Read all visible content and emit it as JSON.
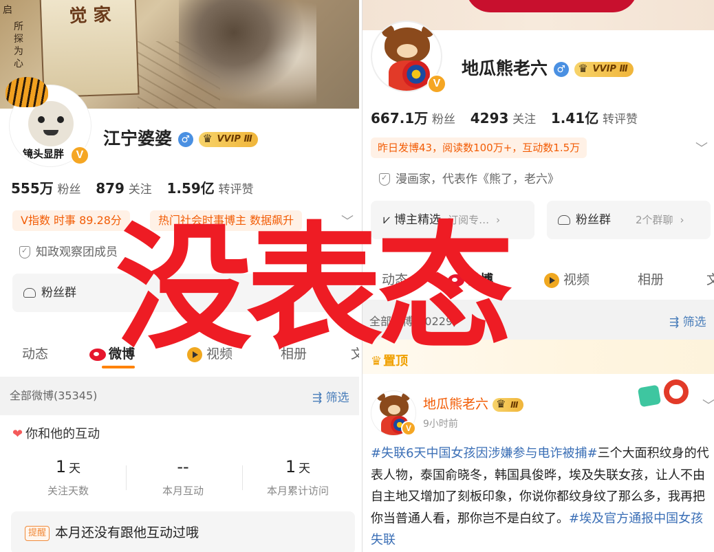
{
  "left": {
    "banner_vertical_1": "启",
    "banner_vertical_2": "所探为心",
    "book_title": "觉 家",
    "avatar_caption": "镜头显胖",
    "v_badge": "V",
    "name": "江宁婆婆",
    "gender_symbol": "♂",
    "vip_label": "VVIP Ⅲ",
    "stats": {
      "followers_value": "555万",
      "followers_label": "粉丝",
      "following_value": "879",
      "following_label": "关注",
      "reposts_value": "1.59亿",
      "reposts_label": "转评赞"
    },
    "tags": [
      "V指数 时事 89.28分",
      "热门社会时事博主 数据飙升"
    ],
    "expand_icon": "chevron-down-icon",
    "auth_text": "知政观察团成员",
    "fans_group_label": "粉丝群",
    "tabs": [
      "动态",
      "微博",
      "视频",
      "相册",
      "文"
    ],
    "active_tab": "微博",
    "all_weibo": "全部微博(35345)",
    "filter_label": "筛选",
    "interaction_title": "你和他的互动",
    "metrics": [
      {
        "value": "1",
        "unit": "天",
        "label": "关注天数"
      },
      {
        "value": "--",
        "unit": "",
        "label": "本月互动"
      },
      {
        "value": "1",
        "unit": "天",
        "label": "本月累计访问"
      }
    ],
    "remind_tag": "提醒",
    "remind_text": "本月还没有跟他互动过哦"
  },
  "right": {
    "name": "地瓜熊老六",
    "gender_symbol": "♂",
    "vip_label": "VVIP Ⅲ",
    "v_badge": "V",
    "stats": {
      "followers_value": "667.1万",
      "followers_label": "粉丝",
      "following_value": "4293",
      "following_label": "关注",
      "reposts_value": "1.41亿",
      "reposts_label": "转评赞"
    },
    "yesterday_info": "昨日发博43，阅读数100万+，互动数1.5万",
    "auth_text": "漫画家，代表作《熊了，老六》",
    "selected_card": {
      "label": "博主精选",
      "sub": "订阅专…"
    },
    "fans_card": {
      "label": "粉丝群",
      "sub": "2个群聊"
    },
    "tabs": [
      "动态",
      "微博",
      "视频",
      "相册",
      "文"
    ],
    "active_tab": "微博",
    "all_weibo": "全部微博(20229)",
    "filter_label": "筛选",
    "pinned_label": "置顶",
    "post": {
      "author": "地瓜熊老六",
      "vip_label": "Ⅲ",
      "time": "9小时前",
      "topic1": "#失联6天中国女孩因涉嫌参与电诈被捕#",
      "body": "三个大面积纹身的代表人物，泰国俞晓冬，韩国具俊晔，埃及失联女孩，让人不由自主地又增加了刻板印象，你说你都纹身纹了那么多，我再把你当普通人看，那你岂不是白纹了。",
      "topic2": "#埃及官方通报中国女孩失联"
    }
  },
  "overlay_text": "没表态"
}
